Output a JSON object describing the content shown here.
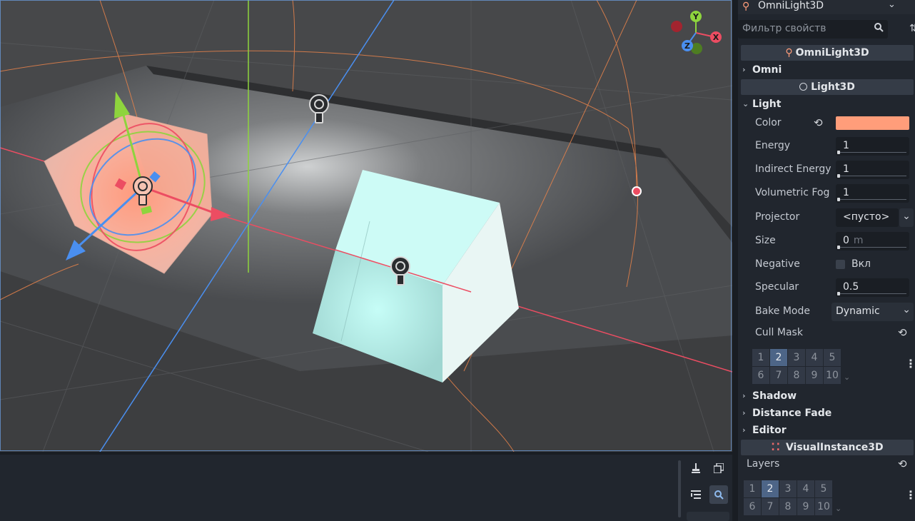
{
  "inspector": {
    "object_name": "OmniLight3D",
    "filter_placeholder": "Фильтр свойств",
    "class_header": "OmniLight3D",
    "omni_group": "Omni",
    "light3d_header": "Light3D",
    "light_group": "Light",
    "properties": {
      "color_label": "Color",
      "color_value": "#ff9d7a",
      "energy_label": "Energy",
      "energy_value": "1",
      "indirect_energy_label": "Indirect Energy",
      "indirect_energy_value": "1",
      "volumetric_fog_label": "Volumetric Fog",
      "volumetric_fog_value": "1",
      "projector_label": "Projector",
      "projector_value": "<пусто>",
      "size_label": "Size",
      "size_value": "0",
      "size_unit": "m",
      "negative_label": "Negative",
      "negative_toggle": "Вкл",
      "specular_label": "Specular",
      "specular_value": "0.5",
      "bake_mode_label": "Bake Mode",
      "bake_mode_value": "Dynamic",
      "cull_mask_label": "Cull Mask"
    },
    "cull_mask_layers": {
      "row1": [
        "1",
        "2",
        "3",
        "4",
        "5"
      ],
      "row2": [
        "6",
        "7",
        "8",
        "9",
        "10"
      ],
      "active": "2"
    },
    "collapsed_groups": [
      "Shadow",
      "Distance Fade",
      "Editor"
    ],
    "visual_instance_header": "VisualInstance3D",
    "layers_label": "Layers",
    "layers": {
      "row1": [
        "1",
        "2",
        "3",
        "4",
        "5"
      ],
      "row2": [
        "6",
        "7",
        "8",
        "9",
        "10"
      ],
      "active": "2"
    }
  },
  "gizmo": {
    "axes": [
      "Y",
      "X",
      "Z"
    ],
    "colors": {
      "x": "#ec4d62",
      "y": "#8ed43d",
      "z": "#4a8ff0"
    }
  },
  "accent": {
    "selection": "#4a8ff0",
    "light_color": "#ff9d7a",
    "cyan_cube": "#bff5ef"
  }
}
